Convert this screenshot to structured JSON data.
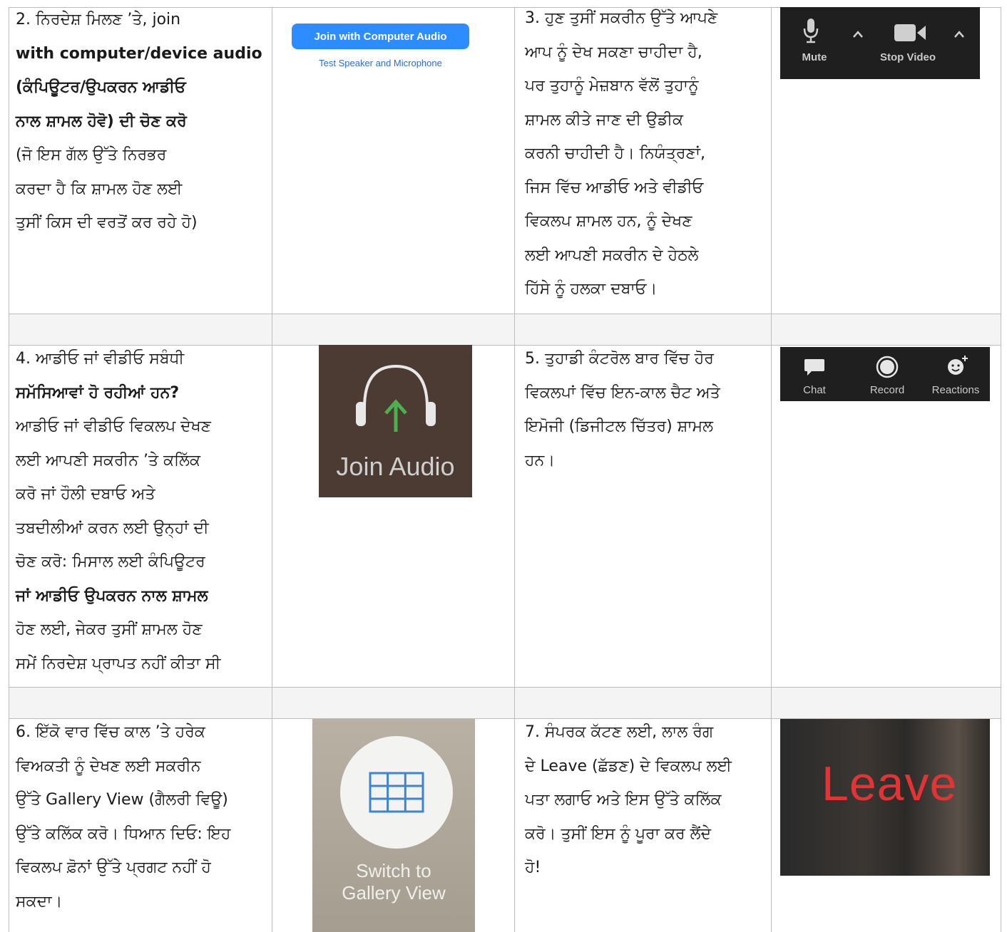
{
  "cells": {
    "c2": [
      "2. ਨਿਰਦੇਸ਼ ਮਿਲਣ ’ਤੇ, join",
      "with computer/device audio",
      "(ਕੰਪਿਊਟਰ/ਉਪਕਰਨ ਆਡੀਓ",
      "ਨਾਲ ਸ਼ਾਮਲ ਹੋਵੋ) ਦੀ ਚੋਣ ਕਰੋ",
      "(ਜੋ ਇਸ ਗੱਲ ਉੱਤੇ ਨਿਰਭਰ",
      "ਕਰਦਾ ਹੈ ਕਿ ਸ਼ਾਮਲ ਹੋਣ ਲਈ",
      "ਤੁਸੀਂ ਕਿਸ ਦੀ ਵਰਤੋਂ ਕਰ ਰਹੇ ਹੋ)"
    ],
    "c3": [
      "3. ਹੁਣ ਤੁਸੀਂ ਸਕਰੀਨ ਉੱਤੇ ਆਪਣੇ",
      "ਆਪ ਨੂੰ ਦੇਖ ਸਕਣਾ ਚਾਹੀਦਾ ਹੈ,",
      "ਪਰ ਤੁਹਾਨੂੰ ਮੇਜ਼ਬਾਨ ਵੱਲੋਂ ਤੁਹਾਨੂੰ",
      "ਸ਼ਾਮਲ ਕੀਤੇ ਜਾਣ ਦੀ ਉਡੀਕ",
      "ਕਰਨੀ ਚਾਹੀਦੀ ਹੈ। ਨਿਯੰਤ੍ਰਣਾਂ,",
      "ਜਿਸ ਵਿੱਚ ਆਡੀਓ ਅਤੇ ਵੀਡੀਓ",
      "ਵਿਕਲਪ ਸ਼ਾਮਲ ਹਨ, ਨੂੰ ਦੇਖਣ",
      "ਲਈ ਆਪਣੀ ਸਕਰੀਨ ਦੇ ਹੇਠਲੇ",
      "ਹਿੱਸੇ ਨੂੰ ਹਲਕਾ ਦਬਾਓ।"
    ],
    "c4": [
      "4. ਆਡੀਓ ਜਾਂ ਵੀਡੀਓ ਸਬੰਧੀ",
      "ਸਮੱਸਿਆਵਾਂ ਹੋ ਰਹੀਆਂ ਹਨ?",
      "ਆਡੀਓ ਜਾਂ ਵੀਡੀਓ ਵਿਕਲਪ ਦੇਖਣ",
      "ਲਈ ਆਪਣੀ ਸਕਰੀਨ ’ਤੇ ਕਲਿੱਕ",
      "ਕਰੋ ਜਾਂ ਹੌਲੀ ਦਬਾਓ ਅਤੇ",
      "ਤਬਦੀਲੀਆਂ ਕਰਨ ਲਈ ਉਨ੍ਹਾਂ ਦੀ",
      "ਚੋਣ ਕਰੋ: ਮਿਸਾਲ ਲਈ ਕੰਪਿਊਟਰ",
      "ਜਾਂ ਆਡੀਓ ਉਪਕਰਨ ਨਾਲ ਸ਼ਾਮਲ",
      "ਹੋਣ ਲਈ, ਜੇਕਰ ਤੁਸੀਂ ਸ਼ਾਮਲ ਹੋਣ",
      "ਸਮੇਂ ਨਿਰਦੇਸ਼ ਪ੍ਰਾਪਤ ਨਹੀਂ ਕੀਤਾ ਸੀ"
    ],
    "c5": [
      "5. ਤੁਹਾਡੀ ਕੰਟਰੋਲ ਬਾਰ ਵਿੱਚ ਹੋਰ",
      "ਵਿਕਲਪਾਂ ਵਿੱਚ ਇਨ-ਕਾਲ ਚੈਟ ਅਤੇ",
      "ਇਮੋਜੀ (ਡਿਜੀਟਲ ਚਿੱਤਰ) ਸ਼ਾਮਲ",
      "ਹਨ।"
    ],
    "c6": [
      "6. ਇੱਕੋ ਵਾਰ ਵਿੱਚ ਕਾਲ ’ਤੇ ਹਰੇਕ",
      "ਵਿਅਕਤੀ ਨੂੰ ਦੇਖਣ ਲਈ ਸਕਰੀਨ",
      "ਉੱਤੇ Gallery View (ਗੈਲਰੀ ਵਿਊ)",
      "ਉੱਤੇ ਕਲਿੱਕ ਕਰੋ। ਧਿਆਨ ਦਿਓ: ਇਹ",
      "ਵਿਕਲਪ ਫ਼ੋਨਾਂ ਉੱਤੇ ਪ੍ਰਗਟ ਨਹੀਂ ਹੋ",
      "ਸਕਦਾ।"
    ],
    "c7": [
      "7. ਸੰਪਰਕ ਕੱਟਣ ਲਈ, ਲਾਲ ਰੰਗ",
      "ਦੇ Leave (ਛੱਡਣ) ਦੇ ਵਿਕਲਪ ਲਈ",
      "ਪਤਾ ਲਗਾਓ ਅਤੇ ਇਸ ਉੱਤੇ ਕਲਿੱਕ",
      "ਕਰੋ। ਤੁਸੀਂ ਇਸ ਨੂੰ ਪੂਰਾ ਕਰ ਲੈਂਦੇ",
      "ਹੋ!"
    ]
  },
  "images": {
    "join_computer_audio": {
      "button": "Join with Computer Audio",
      "link": "Test Speaker and Microphone"
    },
    "mute_bar": {
      "mute": "Mute",
      "stop_video": "Stop Video"
    },
    "join_audio": {
      "label": "Join Audio"
    },
    "controls_bar": {
      "chat": "Chat",
      "record": "Record",
      "reactions": "Reactions"
    },
    "gallery": {
      "line1": "Switch to",
      "line2": "Gallery View"
    },
    "leave": {
      "label": "Leave"
    }
  },
  "colors": {
    "zoom_blue": "#2d8cff",
    "leave_red": "#e23434",
    "arrow_green": "#4caf50"
  }
}
